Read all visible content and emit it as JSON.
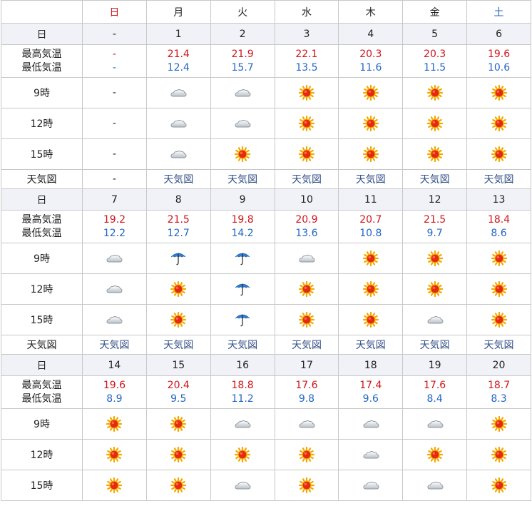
{
  "weekdays": [
    {
      "label": "日",
      "color": "#d0141a"
    },
    {
      "label": "月",
      "color": "#222222"
    },
    {
      "label": "火",
      "color": "#222222"
    },
    {
      "label": "水",
      "color": "#222222"
    },
    {
      "label": "木",
      "color": "#222222"
    },
    {
      "label": "金",
      "color": "#222222"
    },
    {
      "label": "土",
      "color": "#2466c4"
    }
  ],
  "labels": {
    "day": "日",
    "high": "最高気温",
    "low": "最低気温",
    "t9": "9時",
    "t12": "12時",
    "t15": "15時",
    "map": "天気図"
  },
  "colors": {
    "high": "#d0141a",
    "low": "#2466c4",
    "date_row_bg": "#f1f2f7",
    "border": "#c8c8c8"
  },
  "weeks": [
    {
      "days": [
        {
          "date": "-",
          "high": "-",
          "low": "-",
          "w9": "-",
          "w12": "-",
          "w15": "-",
          "map": "-"
        },
        {
          "date": "1",
          "high": "21.4",
          "low": "12.4",
          "w9": "cloud",
          "w12": "cloud",
          "w15": "cloud",
          "map": "天気図"
        },
        {
          "date": "2",
          "high": "21.9",
          "low": "15.7",
          "w9": "cloud",
          "w12": "cloud",
          "w15": "sun",
          "map": "天気図"
        },
        {
          "date": "3",
          "high": "22.1",
          "low": "13.5",
          "w9": "sun",
          "w12": "sun",
          "w15": "sun",
          "map": "天気図"
        },
        {
          "date": "4",
          "high": "20.3",
          "low": "11.6",
          "w9": "sun",
          "w12": "sun",
          "w15": "sun",
          "map": "天気図"
        },
        {
          "date": "5",
          "high": "20.3",
          "low": "11.5",
          "w9": "sun",
          "w12": "sun",
          "w15": "sun",
          "map": "天気図"
        },
        {
          "date": "6",
          "high": "19.6",
          "low": "10.6",
          "w9": "sun",
          "w12": "sun",
          "w15": "sun",
          "map": "天気図"
        }
      ]
    },
    {
      "days": [
        {
          "date": "7",
          "high": "19.2",
          "low": "12.2",
          "w9": "cloud",
          "w12": "cloud",
          "w15": "cloud",
          "map": "天気図"
        },
        {
          "date": "8",
          "high": "21.5",
          "low": "12.7",
          "w9": "rain",
          "w12": "sun",
          "w15": "sun",
          "map": "天気図"
        },
        {
          "date": "9",
          "high": "19.8",
          "low": "14.2",
          "w9": "rain",
          "w12": "rain",
          "w15": "rain",
          "map": "天気図"
        },
        {
          "date": "10",
          "high": "20.9",
          "low": "13.6",
          "w9": "cloud",
          "w12": "sun",
          "w15": "sun",
          "map": "天気図"
        },
        {
          "date": "11",
          "high": "20.7",
          "low": "10.8",
          "w9": "sun",
          "w12": "sun",
          "w15": "sun",
          "map": "天気図"
        },
        {
          "date": "12",
          "high": "21.5",
          "low": "9.7",
          "w9": "sun",
          "w12": "sun",
          "w15": "cloud",
          "map": "天気図"
        },
        {
          "date": "13",
          "high": "18.4",
          "low": "8.6",
          "w9": "sun",
          "w12": "sun",
          "w15": "sun",
          "map": "天気図"
        }
      ]
    },
    {
      "days": [
        {
          "date": "14",
          "high": "19.6",
          "low": "8.9",
          "w9": "sun",
          "w12": "sun",
          "w15": "sun",
          "map": ""
        },
        {
          "date": "15",
          "high": "20.4",
          "low": "9.5",
          "w9": "sun",
          "w12": "sun",
          "w15": "sun",
          "map": ""
        },
        {
          "date": "16",
          "high": "18.8",
          "low": "11.2",
          "w9": "cloud",
          "w12": "sun",
          "w15": "cloud",
          "map": ""
        },
        {
          "date": "17",
          "high": "17.6",
          "low": "9.8",
          "w9": "cloud",
          "w12": "sun",
          "w15": "sun",
          "map": ""
        },
        {
          "date": "18",
          "high": "17.4",
          "low": "9.6",
          "w9": "cloud",
          "w12": "cloud",
          "w15": "cloud",
          "map": ""
        },
        {
          "date": "19",
          "high": "17.6",
          "low": "8.4",
          "w9": "cloud",
          "w12": "sun",
          "w15": "cloud",
          "map": ""
        },
        {
          "date": "20",
          "high": "18.7",
          "low": "8.3",
          "w9": "sun",
          "w12": "sun",
          "w15": "sun",
          "map": ""
        }
      ]
    }
  ]
}
